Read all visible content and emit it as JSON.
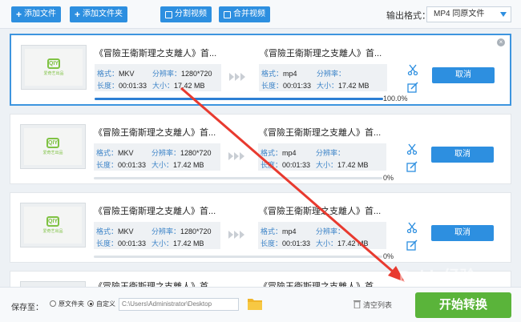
{
  "toolbar": {
    "add_file": "添加文件",
    "add_folder": "添加文件夹",
    "split_video": "分割视频",
    "merge_video": "合并视频",
    "output_format_label": "输出格式：",
    "output_format_value": "MP4  同原文件"
  },
  "labels": {
    "format": "格式：",
    "resolution": "分辨率：",
    "duration": "长度：",
    "size": "大小："
  },
  "items": [
    {
      "thumb_logo": "QIY",
      "thumb_text": "爱奇艺出品",
      "src_title": "《冒險王衛斯理之支離人》首...",
      "src_format": "MKV",
      "src_resolution": "1280*720",
      "src_duration": "00:01:33",
      "src_size": "17.42 MB",
      "dst_title": "《冒險王衛斯理之支離人》首...",
      "dst_format": "mp4",
      "dst_resolution": "分辨率：",
      "dst_duration": "00:01:33",
      "dst_size": "17.42 MB",
      "progress_text": "100.0%",
      "progress": 1.0,
      "cancel": "取消"
    },
    {
      "thumb_logo": "QIY",
      "thumb_text": "爱奇艺出品",
      "src_title": "《冒險王衛斯理之支離人》首...",
      "src_format": "MKV",
      "src_resolution": "1280*720",
      "src_duration": "00:01:33",
      "src_size": "17.42 MB",
      "dst_title": "《冒險王衛斯理之支離人》首...",
      "dst_format": "mp4",
      "dst_duration": "00:01:33",
      "dst_size": "17.42 MB",
      "progress_text": "0%",
      "progress": 0,
      "cancel": "取消"
    },
    {
      "thumb_logo": "QIY",
      "thumb_text": "爱奇艺出品",
      "src_title": "《冒險王衛斯理之支離人》首...",
      "src_format": "MKV",
      "src_resolution": "1280*720",
      "src_duration": "00:01:33",
      "src_size": "17.42 MB",
      "dst_title": "《冒險王衛斯理之支離人》首...",
      "dst_format": "mp4",
      "dst_duration": "00:01:33",
      "dst_size": "17.42 MB",
      "progress_text": "0%",
      "progress": 0,
      "cancel": "取消"
    },
    {
      "src_title": "《冒險王衛斯理之支離人》首...",
      "dst_title": "《冒險王衛斯理之支離人》首..."
    }
  ],
  "bottom": {
    "save_to": "保存至：",
    "option_original": "原文件夹",
    "option_custom": "自定义",
    "path": "C:\\Users\\Administrator\\Desktop",
    "clear_list": "清空列表",
    "start": "开始转换"
  },
  "watermark": "Baidu经验",
  "colors": {
    "accent": "#2d8fe0",
    "start": "#5ab43a",
    "annotation": "#e83a2f"
  }
}
